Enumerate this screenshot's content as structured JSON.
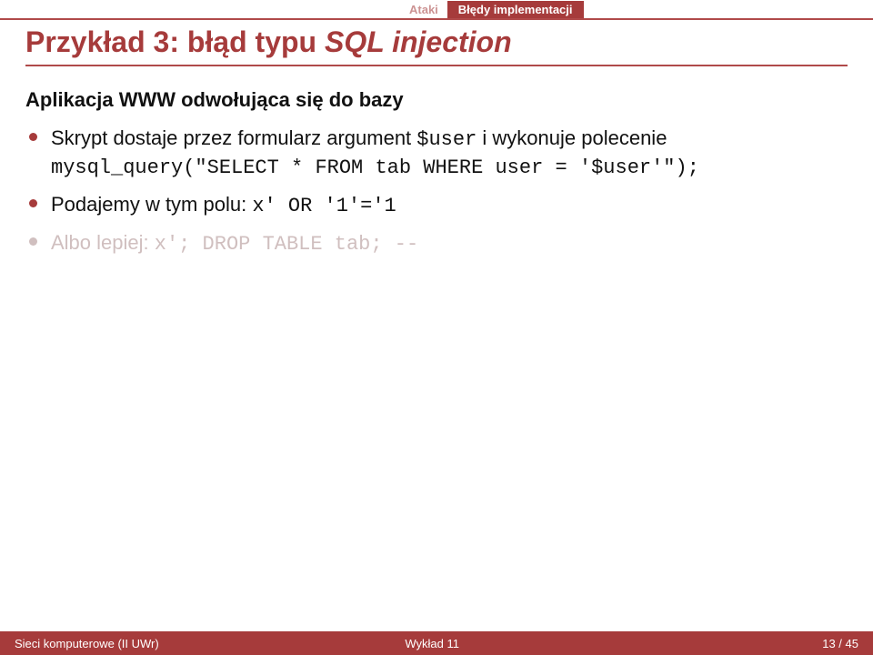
{
  "nav": {
    "section_a": "Ataki",
    "section_b": "Błędy implementacji"
  },
  "title": {
    "prefix": "Przykład 3: błąd typu ",
    "italic": "SQL injection"
  },
  "subheader": "Aplikacja WWW odwołująca się do bazy",
  "bullets": {
    "b1": {
      "t1": "Skrypt dostaje przez formularz argument ",
      "c1": "$user",
      "t2": " i wykonuje polecenie ",
      "c2": "mysql_query(\"SELECT * FROM tab WHERE user = '$user'\");"
    },
    "b2": {
      "t1": "Podajemy w tym polu: ",
      "c1": "x' OR '1'='1"
    },
    "b3": {
      "t1": "Albo lepiej: ",
      "c1": "x'; DROP TABLE tab; --"
    }
  },
  "footer": {
    "left": "Sieci komputerowe (II UWr)",
    "center": "Wykład 11",
    "right": "13 / 45"
  }
}
